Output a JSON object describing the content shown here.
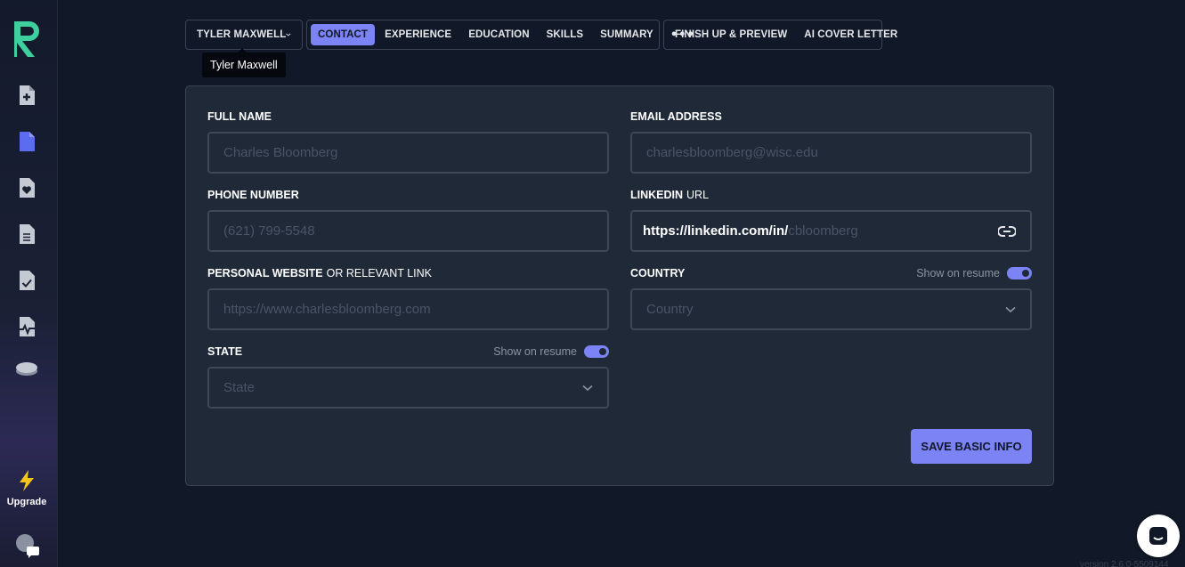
{
  "sidebar": {
    "upgrade_label": "Upgrade",
    "items": [
      {
        "name": "new-resume-icon"
      },
      {
        "name": "resume-icon"
      },
      {
        "name": "favorite-resume-icon"
      },
      {
        "name": "document-list-icon"
      },
      {
        "name": "checked-document-icon"
      },
      {
        "name": "activity-document-icon"
      },
      {
        "name": "coins-icon"
      }
    ]
  },
  "nav": {
    "user_name": "TYLER MAXWELL",
    "tooltip": "Tyler Maxwell",
    "tabs": [
      {
        "label": "CONTACT",
        "active": true
      },
      {
        "label": "EXPERIENCE"
      },
      {
        "label": "EDUCATION"
      },
      {
        "label": "SKILLS"
      },
      {
        "label": "SUMMARY"
      }
    ],
    "more": "•••",
    "finish": "FINISH UP & PREVIEW",
    "cover_letter": "AI COVER LETTER"
  },
  "form": {
    "full_name": {
      "label": "FULL NAME",
      "placeholder": "Charles Bloomberg"
    },
    "email": {
      "label": "EMAIL ADDRESS",
      "placeholder": "charlesbloomberg@wisc.edu"
    },
    "phone": {
      "label": "PHONE NUMBER",
      "placeholder": "(621) 799-5548"
    },
    "linkedin": {
      "label_bold": "LINKEDIN",
      "label_rest": "URL",
      "prefix": "https://linkedin.com/in/",
      "placeholder": "cbloomberg"
    },
    "website": {
      "label_bold": "PERSONAL WEBSITE",
      "label_rest": "OR RELEVANT LINK",
      "placeholder": "https://www.charlesbloomberg.com"
    },
    "country": {
      "label": "COUNTRY",
      "show_on_resume": "Show on resume",
      "placeholder": "Country"
    },
    "state": {
      "label": "STATE",
      "show_on_resume": "Show on resume",
      "placeholder": "State"
    },
    "save_label": "SAVE BASIC INFO"
  },
  "colors": {
    "accent": "#7c83f4",
    "background": "#111827",
    "card": "#1f2937",
    "logo": "#3ecf9e",
    "upgrade": "#f5c518"
  },
  "version": "version 2.6.0-5509144"
}
